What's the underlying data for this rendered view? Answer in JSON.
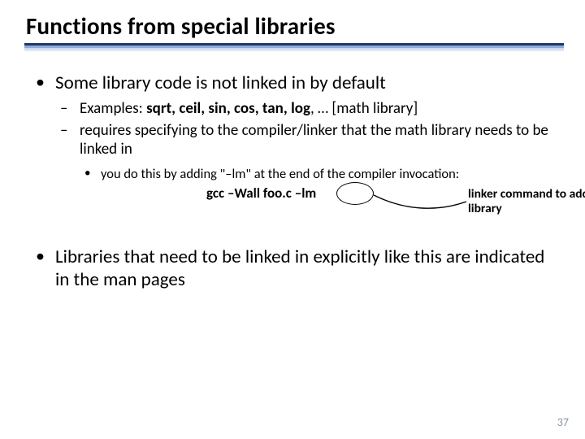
{
  "title": "Functions from special libraries",
  "bullets": {
    "b1": "Some library code is not linked in by default",
    "b1_sub1_prefix": "Examples: ",
    "b1_sub1_bold": "sqrt, ceil, sin, cos, tan, log",
    "b1_sub1_suffix": ", … [math library]",
    "b1_sub2": "requires specifying to the compiler/linker that the math library needs to be linked in",
    "b1_sub2_sub1": "you do this by adding \"–lm\" at the end of the compiler invocation:",
    "cmd": "gcc  –Wall  foo.c  –lm",
    "annotation": "linker command   to add math library",
    "b2": "Libraries that need to be linked in explicitly like this are indicated in the man pages"
  },
  "page_number": "37"
}
